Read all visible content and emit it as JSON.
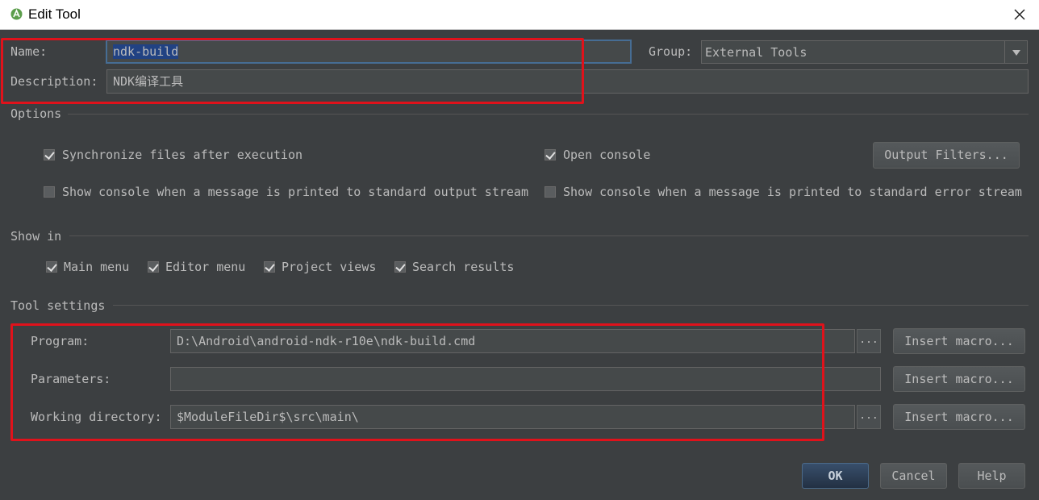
{
  "window": {
    "title": "Edit Tool"
  },
  "form": {
    "name_label": "Name:",
    "name_value": "ndk-build",
    "group_label": "Group:",
    "group_value": "External Tools",
    "description_label": "Description:",
    "description_value": "NDK编译工具"
  },
  "options": {
    "header": "Options",
    "sync_files": {
      "label": "Synchronize files after execution",
      "checked": true
    },
    "open_console": {
      "label": "Open console",
      "checked": true
    },
    "output_filters_label": "Output Filters...",
    "show_console_stdout": {
      "label": "Show console when a message is printed to standard output stream",
      "checked": false
    },
    "show_console_stderr": {
      "label": "Show console when a message is printed to standard error stream",
      "checked": false
    }
  },
  "show_in": {
    "header": "Show in",
    "items": [
      {
        "label": "Main menu",
        "checked": true
      },
      {
        "label": "Editor menu",
        "checked": true
      },
      {
        "label": "Project views",
        "checked": true
      },
      {
        "label": "Search results",
        "checked": true
      }
    ]
  },
  "tool_settings": {
    "header": "Tool settings",
    "program_label": "Program:",
    "program_value": "D:\\Android\\android-ndk-r10e\\ndk-build.cmd",
    "parameters_label": "Parameters:",
    "parameters_value": "",
    "working_dir_label": "Working directory:",
    "working_dir_value": "$ModuleFileDir$\\src\\main\\",
    "browse_label": "...",
    "insert_macro_label": "Insert macro..."
  },
  "footer": {
    "ok_label": "OK",
    "cancel_label": "Cancel",
    "help_label": "Help"
  },
  "colors": {
    "background": "#3c3f41",
    "field": "#45494a",
    "selection": "#214283",
    "highlight_box": "#e0121b",
    "default_button": "#2d4159"
  }
}
